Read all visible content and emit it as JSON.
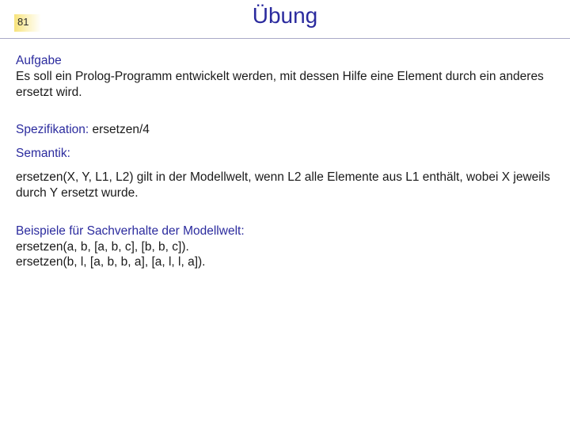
{
  "slide_number": "81",
  "title": "Übung",
  "aufgabe_label": "Aufgabe",
  "aufgabe_text": "Es soll ein Prolog-Programm entwickelt werden, mit dessen Hilfe eine Element durch ein anderes ersetzt wird.",
  "spezifikation_label": "Spezifikation: ",
  "spezifikation_value": "ersetzen/4",
  "semantik_label": "Semantik:",
  "semantik_text": "ersetzen(X, Y, L1, L2) gilt in der Modellwelt, wenn L2 alle Elemente aus L1 enthält, wobei X jeweils durch Y ersetzt wurde.",
  "beispiele_label": "Beispiele für Sachverhalte der Modellwelt:",
  "beispiel_1": "ersetzen(a, b, [a, b, c], [b, b, c]).",
  "beispiel_2": "ersetzen(b, l, [a, b, b, a], [a, l, l, a])."
}
